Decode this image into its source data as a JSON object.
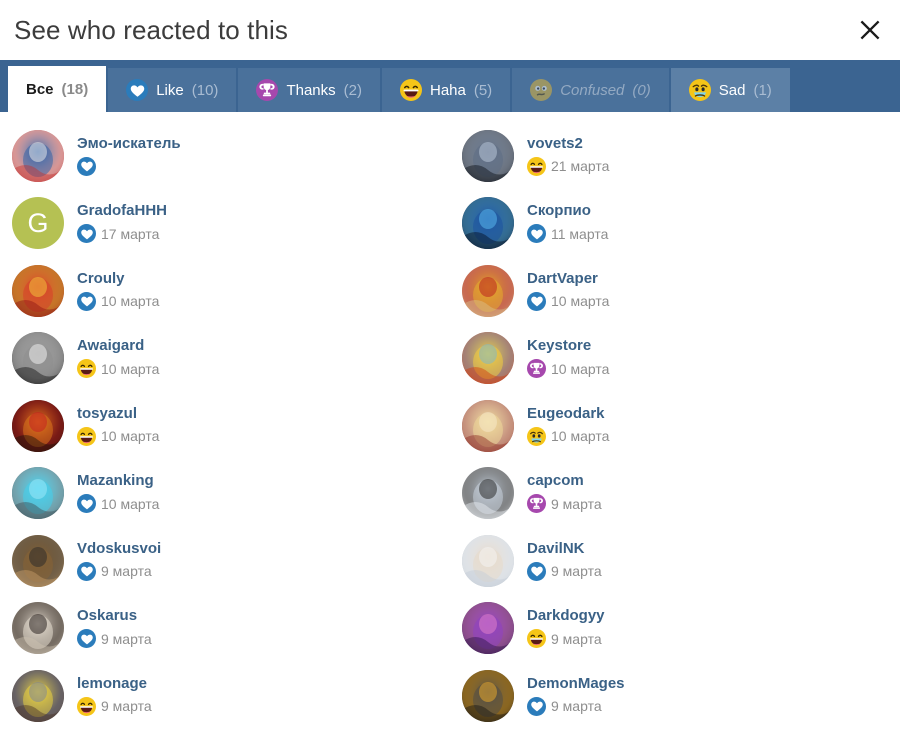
{
  "header": {
    "title": "See who reacted to this",
    "close_label": "×",
    "close_icon": "close-icon"
  },
  "tabs": [
    {
      "id": "all",
      "label": "Все",
      "count": "(18)",
      "icon": null,
      "state": "active"
    },
    {
      "id": "like",
      "label": "Like",
      "count": "(10)",
      "icon": "like",
      "state": "normal"
    },
    {
      "id": "thanks",
      "label": "Thanks",
      "count": "(2)",
      "icon": "thanks",
      "state": "normal"
    },
    {
      "id": "haha",
      "label": "Haha",
      "count": "(5)",
      "icon": "haha",
      "state": "normal"
    },
    {
      "id": "confused",
      "label": "Confused",
      "count": "(0)",
      "icon": "confused",
      "state": "disabled"
    },
    {
      "id": "sad",
      "label": "Sad",
      "count": "(1)",
      "icon": "sad",
      "state": "highlight"
    }
  ],
  "colors": {
    "tabbar_background": "#3b6491",
    "tab_inactive": "#4a719b",
    "tab_highlight": "#5c80a6",
    "tab_active": "#ffffff",
    "username": "#3a6186",
    "date": "#8e8e8e",
    "like": "#2b7cbb",
    "thanks": "#a648ad",
    "haha": "#f5c518",
    "confused": "#ddb43a",
    "sad": "#f5c518",
    "title": "#3c3c3c"
  },
  "users": [
    {
      "name": "Эмо-искатель",
      "date": "",
      "reaction": "like",
      "avatar": {
        "kind": "image",
        "theme": "spiderman",
        "c1": "#c3312f",
        "c2": "#2a5fa8",
        "c3": "#e8e8e8"
      }
    },
    {
      "name": "GradofaHHH",
      "date": "17 марта",
      "reaction": "like",
      "avatar": {
        "kind": "initial",
        "letter": "G",
        "c1": "#b5c153",
        "c2": "#b5c153",
        "c3": "#ffffff"
      }
    },
    {
      "name": "Crouly",
      "date": "10 марта",
      "reaction": "like",
      "avatar": {
        "kind": "image",
        "theme": "redswirl",
        "c1": "#8e1414",
        "c2": "#d83a2a",
        "c3": "#f2c23a"
      }
    },
    {
      "name": "Awaigard",
      "date": "10 марта",
      "reaction": "haha",
      "avatar": {
        "kind": "image",
        "theme": "darkface",
        "c1": "#111111",
        "c2": "#8d8d8d",
        "c3": "#efefef"
      }
    },
    {
      "name": "tosyazul",
      "date": "10 марта",
      "reaction": "haha",
      "avatar": {
        "kind": "image",
        "theme": "firedemon",
        "c1": "#1a1208",
        "c2": "#e07b1c",
        "c3": "#c42020"
      }
    },
    {
      "name": "Mazanking",
      "date": "10 марта",
      "reaction": "like",
      "avatar": {
        "kind": "image",
        "theme": "bluedeer",
        "c1": "#3c4c52",
        "c2": "#3fd2f0",
        "c3": "#9ee8f7"
      }
    },
    {
      "name": "Vdoskusvoi",
      "date": "9 марта",
      "reaction": "like",
      "avatar": {
        "kind": "image",
        "theme": "woodsign",
        "c1": "#c9a06a",
        "c2": "#8a6434",
        "c3": "#2b2b2b"
      }
    },
    {
      "name": "Oskarus",
      "date": "9 марта",
      "reaction": "like",
      "avatar": {
        "kind": "image",
        "theme": "dogface",
        "c1": "#cfc3b2",
        "c2": "#f0e7da",
        "c3": "#2a2320"
      }
    },
    {
      "name": "lemonage",
      "date": "9 марта",
      "reaction": "haha",
      "avatar": {
        "kind": "image",
        "theme": "lemonsuit",
        "c1": "#4a3328",
        "c2": "#f2d83c",
        "c3": "#7f8794"
      }
    },
    {
      "name": "vovets2",
      "date": "21 марта",
      "reaction": "haha",
      "avatar": {
        "kind": "image",
        "theme": "darkposter",
        "c1": "#0c0f16",
        "c2": "#5b6b84",
        "c3": "#b9c6d8"
      }
    },
    {
      "name": "Скорпио",
      "date": "11 марта",
      "reaction": "like",
      "avatar": {
        "kind": "image",
        "theme": "bluevortex",
        "c1": "#050d1e",
        "c2": "#1a4fa0",
        "c3": "#59b8ef"
      }
    },
    {
      "name": "DartVaper",
      "date": "10 марта",
      "reaction": "like",
      "avatar": {
        "kind": "image",
        "theme": "goldhall",
        "c1": "#d9c38d",
        "c2": "#e8b22a",
        "c3": "#b92020"
      }
    },
    {
      "name": "Keystore",
      "date": "10 марта",
      "reaction": "thanks",
      "avatar": {
        "kind": "image",
        "theme": "fireorb",
        "c1": "#d33a0c",
        "c2": "#f7d23a",
        "c3": "#7fb8c9"
      }
    },
    {
      "name": "Eugeodark",
      "date": "10 марта",
      "reaction": "sad",
      "avatar": {
        "kind": "image",
        "theme": "blondeanime",
        "c1": "#8c2a22",
        "c2": "#f0dc9a",
        "c3": "#f5e7c8"
      }
    },
    {
      "name": "capcom",
      "date": "9 марта",
      "reaction": "thanks",
      "avatar": {
        "kind": "image",
        "theme": "whitehairanime",
        "c1": "#eef2f6",
        "c2": "#cdd8e4",
        "c3": "#2a2a2a"
      }
    },
    {
      "name": "DavilNK",
      "date": "9 марта",
      "reaction": "like",
      "avatar": {
        "kind": "image",
        "theme": "photoperson",
        "c1": "#c3ccd6",
        "c2": "#e8d9c8",
        "c3": "#f4f4f4"
      }
    },
    {
      "name": "Darkdogyy",
      "date": "9 марта",
      "reaction": "haha",
      "avatar": {
        "kind": "image",
        "theme": "purplegalaxy",
        "c1": "#2a1247",
        "c2": "#8e3fc4",
        "c3": "#e080c8"
      }
    },
    {
      "name": "DemonMages",
      "date": "9 марта",
      "reaction": "like",
      "avatar": {
        "kind": "image",
        "theme": "skullhat",
        "c1": "#151515",
        "c2": "#4a4a4a",
        "c3": "#e8a72a"
      }
    }
  ]
}
